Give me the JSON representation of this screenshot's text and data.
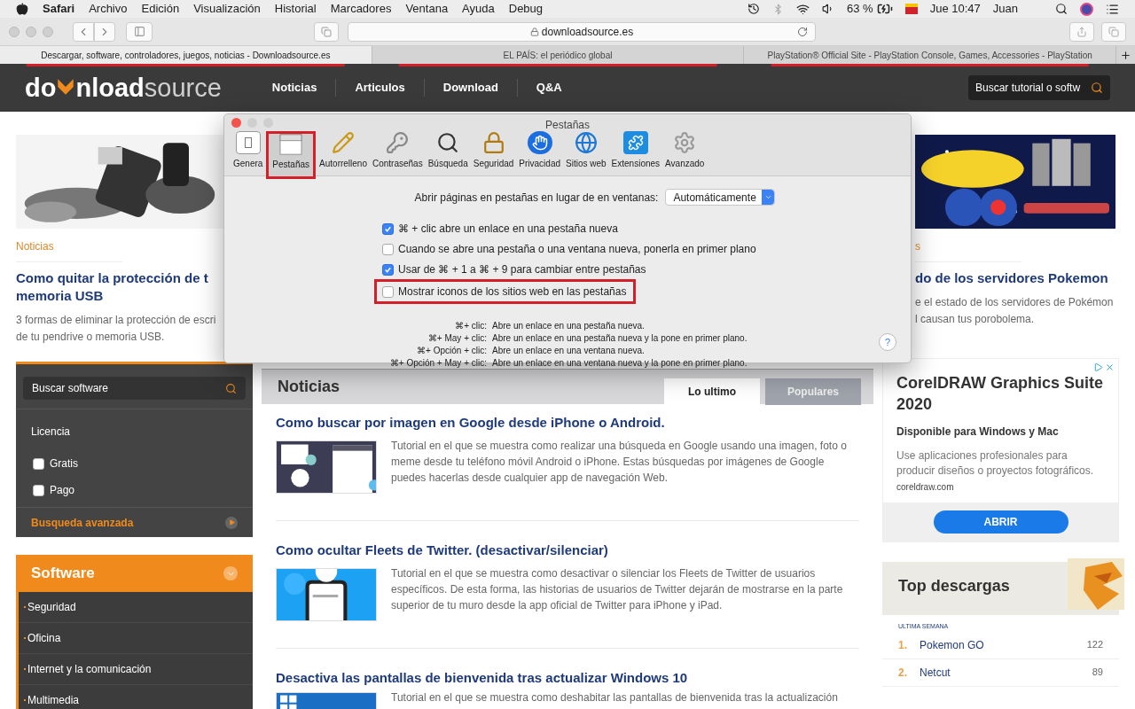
{
  "menubar": {
    "app": "Safari",
    "menus": [
      "Archivo",
      "Edición",
      "Visualización",
      "Historial",
      "Marcadores",
      "Ventana",
      "Ayuda",
      "Debug"
    ],
    "battery": "63 %",
    "clock": "Jue 10:47",
    "user": "Juan"
  },
  "toolbar": {
    "url": "downloadsource.es"
  },
  "tabs": [
    {
      "title": "Descargar, software, controladores, juegos, noticias - Downloadsource.es",
      "selected": true,
      "underlined": true
    },
    {
      "title": "EL PAÍS: el periódico global",
      "selected": false,
      "underlined": true
    },
    {
      "title": "PlayStation® Official Site - PlayStation Console, Games, Accessories - PlayStation",
      "selected": false,
      "underlined": true
    }
  ],
  "site": {
    "logo": {
      "part_1": "do",
      "part_2": "nload",
      "part_3": "source"
    },
    "nav": [
      "Noticias",
      "Articulos",
      "Download",
      "Q&A"
    ],
    "search": {
      "placeholder": "Buscar tutorial o softw"
    }
  },
  "featured": [
    {
      "category": "Noticias",
      "title_lines": [
        "Como quitar la protección de t",
        "memoria USB"
      ],
      "description_lines": [
        "3 formas de eliminar la protección de escri",
        "de tu pendrive o memoria USB."
      ]
    },
    {
      "category": "s",
      "title_lines": [
        "do de los servidores Pokemon"
      ],
      "description_lines": [
        "e el estado de los servidores de Pokémon",
        "l causan tus porobolema."
      ]
    }
  ],
  "prefs": {
    "title": "Pestañas",
    "panes": [
      {
        "label": "Genera",
        "selected": false,
        "highlighted": false
      },
      {
        "label": "Pestañas",
        "selected": true,
        "highlighted": true
      },
      {
        "label": "Autorrelleno",
        "selected": false,
        "highlighted": false
      },
      {
        "label": "Contraseñas",
        "selected": false,
        "highlighted": false
      },
      {
        "label": "Búsqueda",
        "selected": false,
        "highlighted": false
      },
      {
        "label": "Seguridad",
        "selected": false,
        "highlighted": false
      },
      {
        "label": "Privacidad",
        "selected": false,
        "highlighted": false
      },
      {
        "label": "Sitios web",
        "selected": false,
        "highlighted": false
      },
      {
        "label": "Extensiones",
        "selected": false,
        "highlighted": false
      },
      {
        "label": "Avanzado",
        "selected": false,
        "highlighted": false
      }
    ],
    "open_label": "Abrir páginas en pestañas en lugar de en ventanas:",
    "open_value": "Automáticamente",
    "options": [
      {
        "label": "⌘ + clic abre un enlace en una pestaña nueva",
        "checked": true,
        "highlighted": false
      },
      {
        "label": "Cuando se abre una pestaña o una ventana nueva, ponerla en primer plano",
        "checked": false,
        "highlighted": false
      },
      {
        "label": "Usar de ⌘ + 1 a ⌘ + 9 para cambiar entre pestañas",
        "checked": true,
        "highlighted": false
      },
      {
        "label": "Mostrar iconos de los sitios web en las pestañas",
        "checked": false,
        "highlighted": true
      }
    ],
    "shortcuts": [
      {
        "keys": "⌘+ clic:",
        "action": "Abre un enlace en una pestaña nueva."
      },
      {
        "keys": "⌘+ May + clic:",
        "action": "Abre un enlace en una pestaña nueva y la pone en primer plano."
      },
      {
        "keys": "⌘+ Opción + clic:",
        "action": "Abre un enlace en una ventana nueva."
      },
      {
        "keys": "⌘+ Opción + May + clic:",
        "action": "Abre un enlace en una ventana nueva y la pone en primer plano."
      }
    ],
    "help": "?"
  },
  "sidebar": {
    "search_placeholder": "Buscar software",
    "license_label": "Licencia",
    "filters": [
      {
        "label": "Gratis",
        "checked": false
      },
      {
        "label": "Pago",
        "checked": false
      }
    ],
    "advanced": "Busqueda avanzada",
    "category": {
      "title": "Software",
      "expanded": true,
      "items": [
        "Seguridad",
        "Oficina",
        "Internet y la comunicación",
        "Multimedia"
      ]
    }
  },
  "news": {
    "title": "Noticias",
    "tabs": [
      {
        "label": "Lo ultimo",
        "selected": true
      },
      {
        "label": "Populares",
        "selected": false
      }
    ],
    "articles": [
      {
        "title": "Como buscar por imagen en Google desde iPhone o Android.",
        "description": "Tutorial en el que se muestra como realizar una búsqueda en Google usando una imagen, foto o meme desde tu teléfono móvil Android o iPhone. Estas búsquedas por imágenes de Google puedes hacerlas desde cualquier app de navegación Web."
      },
      {
        "title": "Como ocultar Fleets de Twitter. (desactivar/silenciar)",
        "description": "Tutorial en el que se muestra como desactivar o silenciar los Fleets de Twitter de usuarios específicos. De esta forma, las historias de usuarios de Twitter dejarán de mostrarse en la parte superior de tu muro desde la app oficial de Twitter para iPhone y iPad."
      },
      {
        "title": "Desactiva las pantallas de bienvenida tras actualizar Windows 10",
        "description": "Tutorial en el que se muestra como deshabitar las pantallas de bienvenida tras la actualización"
      }
    ]
  },
  "ad": {
    "title": "CorelDRAW Graphics Suite 2020",
    "subtitle": "Disponible para Windows y Mac",
    "body": "Use aplicaciones profesionales para producir diseños o proyectos fotográficos.",
    "domain": "coreldraw.com",
    "cta": "ABRIR"
  },
  "top": {
    "title": "Top descargas",
    "period": "ULTIMA SEMANA",
    "items": [
      {
        "rank": "1.",
        "name": "Pokemon GO",
        "count": "122"
      },
      {
        "rank": "2.",
        "name": "Netcut",
        "count": "89"
      }
    ]
  }
}
